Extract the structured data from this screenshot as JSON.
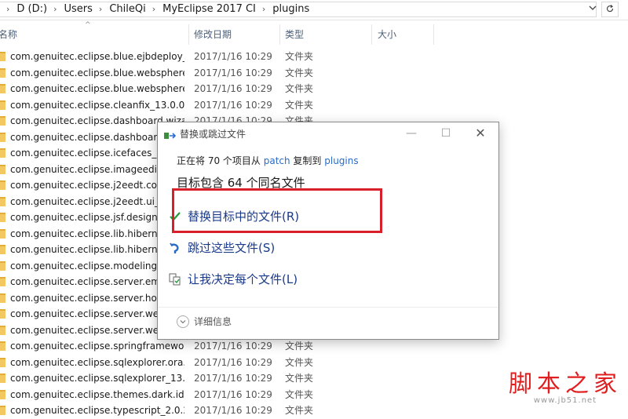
{
  "address_bar": {
    "crumbs": [
      "D (D:)",
      "Users",
      "ChileQi",
      "MyEclipse 2017 CI",
      "plugins"
    ],
    "dropdown_icon": "chevron-down-icon",
    "refresh_icon": "refresh-icon"
  },
  "columns": {
    "name": "名称",
    "modified": "修改日期",
    "type": "类型",
    "size": "大小"
  },
  "files": [
    {
      "name": "com.genuitec.eclipse.blue.ejbdeploy_...",
      "date": "2017/1/16 10:29",
      "type": "文件夹"
    },
    {
      "name": "com.genuitec.eclipse.blue.websphere...",
      "date": "2017/1/16 10:29",
      "type": "文件夹"
    },
    {
      "name": "com.genuitec.eclipse.blue.websphere...",
      "date": "2017/1/16 10:29",
      "type": "文件夹"
    },
    {
      "name": "com.genuitec.eclipse.cleanfix_13.0.0....",
      "date": "2017/1/16 10:29",
      "type": "文件夹"
    },
    {
      "name": "com.genuitec.eclipse.dashboard.wiza",
      "date": "2017/1/16 10:29",
      "type": "文件夹"
    },
    {
      "name": "com.genuitec.eclipse.dashboard_",
      "date": "",
      "type": ""
    },
    {
      "name": "com.genuitec.eclipse.icefaces_13.",
      "date": "",
      "type": ""
    },
    {
      "name": "com.genuitec.eclipse.imageeditor",
      "date": "",
      "type": ""
    },
    {
      "name": "com.genuitec.eclipse.j2eedt.core_",
      "date": "",
      "type": ""
    },
    {
      "name": "com.genuitec.eclipse.j2eedt.ui_13",
      "date": "",
      "type": ""
    },
    {
      "name": "com.genuitec.eclipse.jsf.designer_",
      "date": "",
      "type": ""
    },
    {
      "name": "com.genuitec.eclipse.lib.hibernate",
      "date": "",
      "type": ""
    },
    {
      "name": "com.genuitec.eclipse.lib.hibernate",
      "date": "",
      "type": ""
    },
    {
      "name": "com.genuitec.eclipse.modeling.co",
      "date": "",
      "type": ""
    },
    {
      "name": "com.genuitec.eclipse.server.embe",
      "date": "",
      "type": ""
    },
    {
      "name": "com.genuitec.eclipse.server.hotre",
      "date": "",
      "type": ""
    },
    {
      "name": "com.genuitec.eclipse.server.weblo",
      "date": "",
      "type": ""
    },
    {
      "name": "com.genuitec.eclipse.server.weblo",
      "date": "",
      "type": ""
    },
    {
      "name": "com.genuitec.eclipse.springframewor...",
      "date": "2017/1/16 10:29",
      "type": "文件夹"
    },
    {
      "name": "com.genuitec.eclipse.sqlexplorer.ora...",
      "date": "2017/1/16 10:29",
      "type": "文件夹"
    },
    {
      "name": "com.genuitec.eclipse.sqlexplorer_13....",
      "date": "2017/1/16 10:29",
      "type": "文件夹"
    },
    {
      "name": "com.genuitec.eclipse.themes.dark.ide...",
      "date": "2017/1/16 10:29",
      "type": "文件夹"
    },
    {
      "name": "com.genuitec.eclipse.typescript_2.0.2",
      "date": "2017/1/16 10:29",
      "type": "文件夹"
    }
  ],
  "dialog": {
    "title": "替换或跳过文件",
    "line1_prefix": "正在将 70 个项目从 ",
    "source": "patch",
    "line1_middle": " 复制到 ",
    "dest": "plugins",
    "line2": "目标包含 64 个同名文件",
    "opt_replace": "替换目标中的文件(R)",
    "opt_skip": "跳过这些文件(S)",
    "opt_decide": "让我决定每个文件(L)",
    "details": "详细信息",
    "icons": {
      "title": "copy-arrow-icon",
      "replace": "checkmark-icon",
      "skip": "skip-arrow-icon",
      "decide": "file-compare-icon",
      "details": "chevron-down-icon"
    },
    "accent_color": "#2a6cc9",
    "highlight_color": "#d9202a"
  },
  "watermark": {
    "title": "脚本之家",
    "url": "www.jb51.net"
  }
}
